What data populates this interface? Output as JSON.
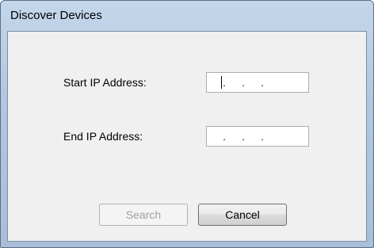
{
  "window": {
    "title": "Discover Devices"
  },
  "form": {
    "start_ip_label": "Start IP Address:",
    "end_ip_label": "End IP Address:",
    "start_ip_value": "",
    "end_ip_value": "",
    "ip_separator": "."
  },
  "buttons": {
    "search_label": "Search",
    "search_enabled": false,
    "cancel_label": "Cancel"
  },
  "colors": {
    "title_gradient_top": "#c4d6ea",
    "title_gradient_bottom": "#a9bed8",
    "client_background": "#f0f0f0",
    "disabled_text": "#a0a0a0"
  }
}
